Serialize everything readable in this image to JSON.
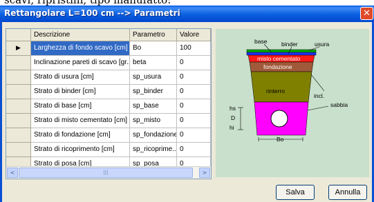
{
  "window": {
    "title": "Rettangolare L=100 cm --> Parametri",
    "close_glyph": "✕",
    "background_caption": "scavi, ripristini, tipo manufatto:"
  },
  "table": {
    "row_indicator": "▶",
    "columns": [
      "Descrizione",
      "Parametro",
      "Valore"
    ],
    "rows": [
      {
        "descrizione": "Larghezza di fondo scavo [cm]",
        "parametro": "Bo",
        "valore": "100",
        "selected": true
      },
      {
        "descrizione": "Inclinazione pareti di scavo [gr...",
        "parametro": "beta",
        "valore": "0"
      },
      {
        "descrizione": "Strato di usura [cm]",
        "parametro": "sp_usura",
        "valore": "0"
      },
      {
        "descrizione": "Strato di binder [cm]",
        "parametro": "sp_binder",
        "valore": "0"
      },
      {
        "descrizione": "Strato di base [cm]",
        "parametro": "sp_base",
        "valore": "0"
      },
      {
        "descrizione": "Strato di misto cementato [cm]",
        "parametro": "sp_misto",
        "valore": "0"
      },
      {
        "descrizione": "Strato di fondazione [cm]",
        "parametro": "sp_fondazione",
        "valore": "0"
      },
      {
        "descrizione": "Strato di ricoprimento [cm]",
        "parametro": "sp_ricoprime...",
        "valore": "0"
      },
      {
        "descrizione": "Strato di posa [cm]",
        "parametro": "sp_posa",
        "valore": "0"
      }
    ],
    "scroll_left": "<",
    "scroll_right": ">",
    "scroll_thumb_grip": "|||"
  },
  "diagram": {
    "labels": {
      "base": "base",
      "binder": "binder",
      "usura": "usura",
      "misto": "misto cementato",
      "fondazione": "fondazione",
      "incl": "incl.",
      "rinterro": "rinterro",
      "sabbia": "sabbia",
      "hs": "hs",
      "D": "D",
      "hi": "hi",
      "Bo": "Bo"
    },
    "colors": {
      "background": "#c8e0cc",
      "usura": "#00aa00",
      "binder": "#2233ff",
      "misto": "#ff1a1a",
      "fondazione": "#a05a3a",
      "rinterro": "#808000",
      "sabbia": "#ff00ff"
    }
  },
  "buttons": {
    "ok": "Salva",
    "cancel": "Annulla"
  }
}
